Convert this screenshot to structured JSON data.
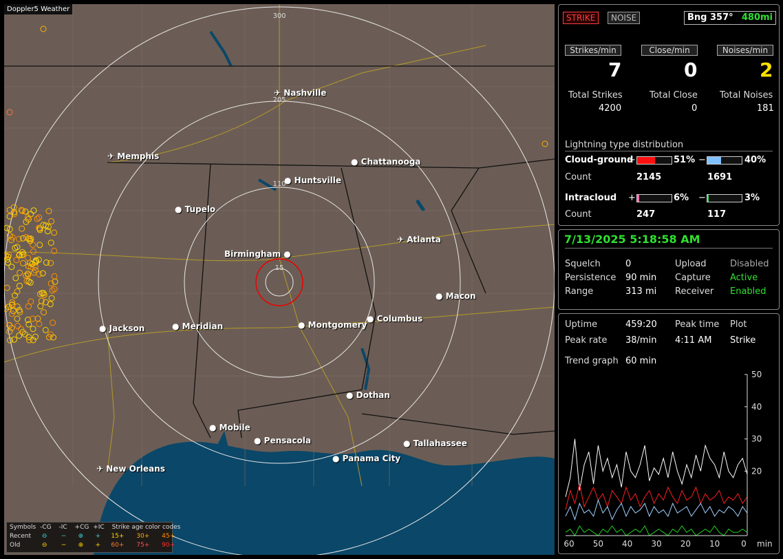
{
  "app": {
    "title": "Doppler5 Weather"
  },
  "map": {
    "range_labels": [
      "300",
      "205",
      "110",
      "15"
    ],
    "cities": [
      {
        "name": "Nashville",
        "airport": true
      },
      {
        "name": "Memphis",
        "airport": true
      },
      {
        "name": "Chattanooga",
        "airport": false
      },
      {
        "name": "Huntsville",
        "airport": false
      },
      {
        "name": "Tupelo",
        "airport": false
      },
      {
        "name": "Birmingham",
        "airport": false
      },
      {
        "name": "Atlanta",
        "airport": true
      },
      {
        "name": "Macon",
        "airport": false
      },
      {
        "name": "Jackson",
        "airport": false
      },
      {
        "name": "Meridian",
        "airport": false
      },
      {
        "name": "Montgomery",
        "airport": false
      },
      {
        "name": "Columbus",
        "airport": false
      },
      {
        "name": "Dothan",
        "airport": false
      },
      {
        "name": "Mobile",
        "airport": false
      },
      {
        "name": "Pensacola",
        "airport": false
      },
      {
        "name": "Tallahassee",
        "airport": false
      },
      {
        "name": "Panama City",
        "airport": false
      },
      {
        "name": "New Orleans",
        "airport": true
      }
    ],
    "legend": {
      "symbols_label": "Symbols",
      "neg_cg": "-CG",
      "neg_ic": "-IC",
      "pos_cg": "+CG",
      "pos_ic": "+IC",
      "age_label": "Strike age color codes",
      "recent_label": "Recent",
      "old_label": "Old",
      "recent_ages": [
        "15+",
        "30+",
        "45+"
      ],
      "old_ages": [
        "60+",
        "75+",
        "90+"
      ],
      "recent_sym": [
        "⊖",
        "−",
        "⊕",
        "+"
      ],
      "old_sym": [
        "⊖",
        "−",
        "⊕",
        "+"
      ]
    }
  },
  "top": {
    "strike_button": "STRIKE",
    "noise_button": "NOISE",
    "bearing": "Bng 357°",
    "range": "480mi",
    "strikes_min_label": "Strikes/min",
    "close_min_label": "Close/min",
    "noises_min_label": "Noises/min",
    "strikes_min": "7",
    "close_min": "0",
    "noises_min": "2",
    "total_strikes_label": "Total Strikes",
    "total_close_label": "Total Close",
    "total_noises_label": "Total Noises",
    "total_strikes": "4200",
    "total_close": "0",
    "total_noises": "181",
    "dist_title": "Lightning type distribution",
    "cg_label": "Cloud-ground",
    "ic_label": "Intracloud",
    "count_label": "Count",
    "plus": "+",
    "minus": "−",
    "cg_pos_pct": "51%",
    "cg_neg_pct": "40%",
    "cg_pos_count": "2145",
    "cg_neg_count": "1691",
    "ic_pos_pct": "6%",
    "ic_neg_pct": "3%",
    "ic_pos_count": "247",
    "ic_neg_count": "117",
    "bars": {
      "cg_pos": 0.51,
      "cg_neg": 0.4,
      "ic_pos": 0.06,
      "ic_neg": 0.03
    }
  },
  "status": {
    "datetime": "7/13/2025 5:18:58 AM",
    "squelch_label": "Squelch",
    "squelch": "0",
    "persistence_label": "Persistence",
    "persistence": "90 min",
    "range_label": "Range",
    "range": "313 mi",
    "upload_label": "Upload",
    "upload": "Disabled",
    "capture_label": "Capture",
    "capture": "Active",
    "receiver_label": "Receiver",
    "receiver": "Enabled"
  },
  "trend": {
    "uptime_label": "Uptime",
    "uptime": "459:20",
    "peak_time_label": "Peak time",
    "peak_time": "4:11 AM",
    "plot_label": "Plot",
    "plot": "Strike",
    "peak_rate_label": "Peak rate",
    "peak_rate": "38/min",
    "trend_graph_label": "Trend graph",
    "trend_graph": "60 min",
    "y_ticks": [
      "50",
      "40",
      "30",
      "20"
    ],
    "x_ticks": [
      "60",
      "50",
      "40",
      "30",
      "20",
      "10",
      "0"
    ],
    "x_unit": "min"
  },
  "chart_data": {
    "type": "line",
    "x_range": [
      60,
      0
    ],
    "ylim": [
      0,
      50
    ],
    "series": [
      {
        "color": "#ffffff",
        "values": [
          12,
          18,
          30,
          14,
          22,
          26,
          16,
          28,
          20,
          24,
          18,
          22,
          15,
          26,
          20,
          18,
          22,
          28,
          17,
          21,
          19,
          24,
          18,
          26,
          20,
          16,
          22,
          18,
          25,
          20,
          28,
          24,
          22,
          18,
          26,
          20,
          18,
          22,
          24,
          19
        ]
      },
      {
        "color": "#ff2020",
        "values": [
          8,
          14,
          10,
          16,
          9,
          12,
          15,
          11,
          13,
          9,
          14,
          12,
          10,
          15,
          11,
          13,
          9,
          12,
          14,
          10,
          13,
          11,
          15,
          12,
          10,
          14,
          11,
          12,
          15,
          10,
          13,
          11,
          12,
          14,
          10,
          12,
          11,
          13,
          10,
          12
        ]
      },
      {
        "color": "#9fd0ff",
        "values": [
          6,
          9,
          5,
          10,
          7,
          8,
          6,
          11,
          7,
          9,
          5,
          8,
          10,
          6,
          9,
          7,
          8,
          10,
          6,
          9,
          7,
          8,
          6,
          10,
          7,
          8,
          9,
          6,
          8,
          10,
          7,
          9,
          6,
          8,
          7,
          9,
          8,
          6,
          9,
          7
        ]
      },
      {
        "color": "#20d020",
        "values": [
          1,
          2,
          0,
          3,
          1,
          2,
          1,
          0,
          2,
          1,
          3,
          1,
          2,
          0,
          1,
          2,
          1,
          3,
          0,
          1,
          2,
          1,
          0,
          2,
          1,
          3,
          1,
          2,
          0,
          1,
          2,
          1,
          3,
          1,
          0,
          2,
          1,
          1,
          2,
          1
        ]
      }
    ]
  }
}
